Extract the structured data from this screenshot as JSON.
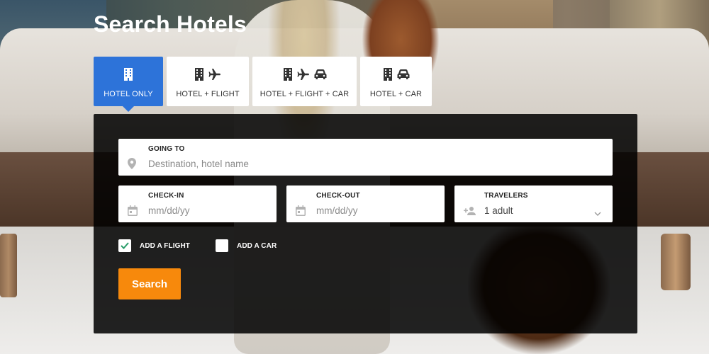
{
  "page": {
    "title": "Search Hotels"
  },
  "tabs": [
    {
      "label": "HOTEL ONLY",
      "icons": [
        "building-icon"
      ],
      "active": true
    },
    {
      "label": "HOTEL + FLIGHT",
      "icons": [
        "building-icon",
        "plane-icon"
      ],
      "active": false
    },
    {
      "label": "HOTEL + FLIGHT + CAR",
      "icons": [
        "building-icon",
        "plane-icon",
        "car-icon"
      ],
      "active": false
    },
    {
      "label": "HOTEL + CAR",
      "icons": [
        "building-icon",
        "car-icon"
      ],
      "active": false
    }
  ],
  "form": {
    "going_to": {
      "label": "GOING TO",
      "placeholder": "Destination, hotel name",
      "icon": "location-pin-icon"
    },
    "check_in": {
      "label": "CHECK-IN",
      "placeholder": "mm/dd/yy",
      "icon": "calendar-icon"
    },
    "check_out": {
      "label": "CHECK-OUT",
      "placeholder": "mm/dd/yy",
      "icon": "calendar-icon"
    },
    "travelers": {
      "label": "TRAVELERS",
      "value": "1 adult",
      "icon": "add-person-icon"
    },
    "add_flight": {
      "label": "ADD A FLIGHT",
      "checked": true
    },
    "add_car": {
      "label": "ADD A CAR",
      "checked": false
    },
    "search_label": "Search"
  },
  "colors": {
    "active_tab": "#2d73d9",
    "search_button": "#f7890c",
    "checkmark": "#2a9d6a",
    "panel": "#000000"
  }
}
